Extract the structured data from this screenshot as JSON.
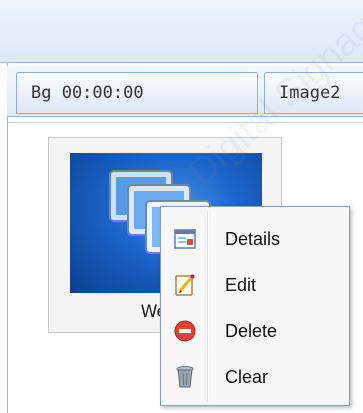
{
  "tabs": [
    {
      "label": "Bg   00:00:00"
    },
    {
      "label": "Image2"
    }
  ],
  "item": {
    "label": "WebR",
    "icon": "computers-icon"
  },
  "context_menu": {
    "items": [
      {
        "label": "Details",
        "icon": "details-icon"
      },
      {
        "label": "Edit",
        "icon": "edit-icon"
      },
      {
        "label": "Delete",
        "icon": "delete-icon"
      },
      {
        "label": "Clear",
        "icon": "trash-icon"
      }
    ]
  },
  "watermark": {
    "text": "Digital Signage CMS"
  }
}
